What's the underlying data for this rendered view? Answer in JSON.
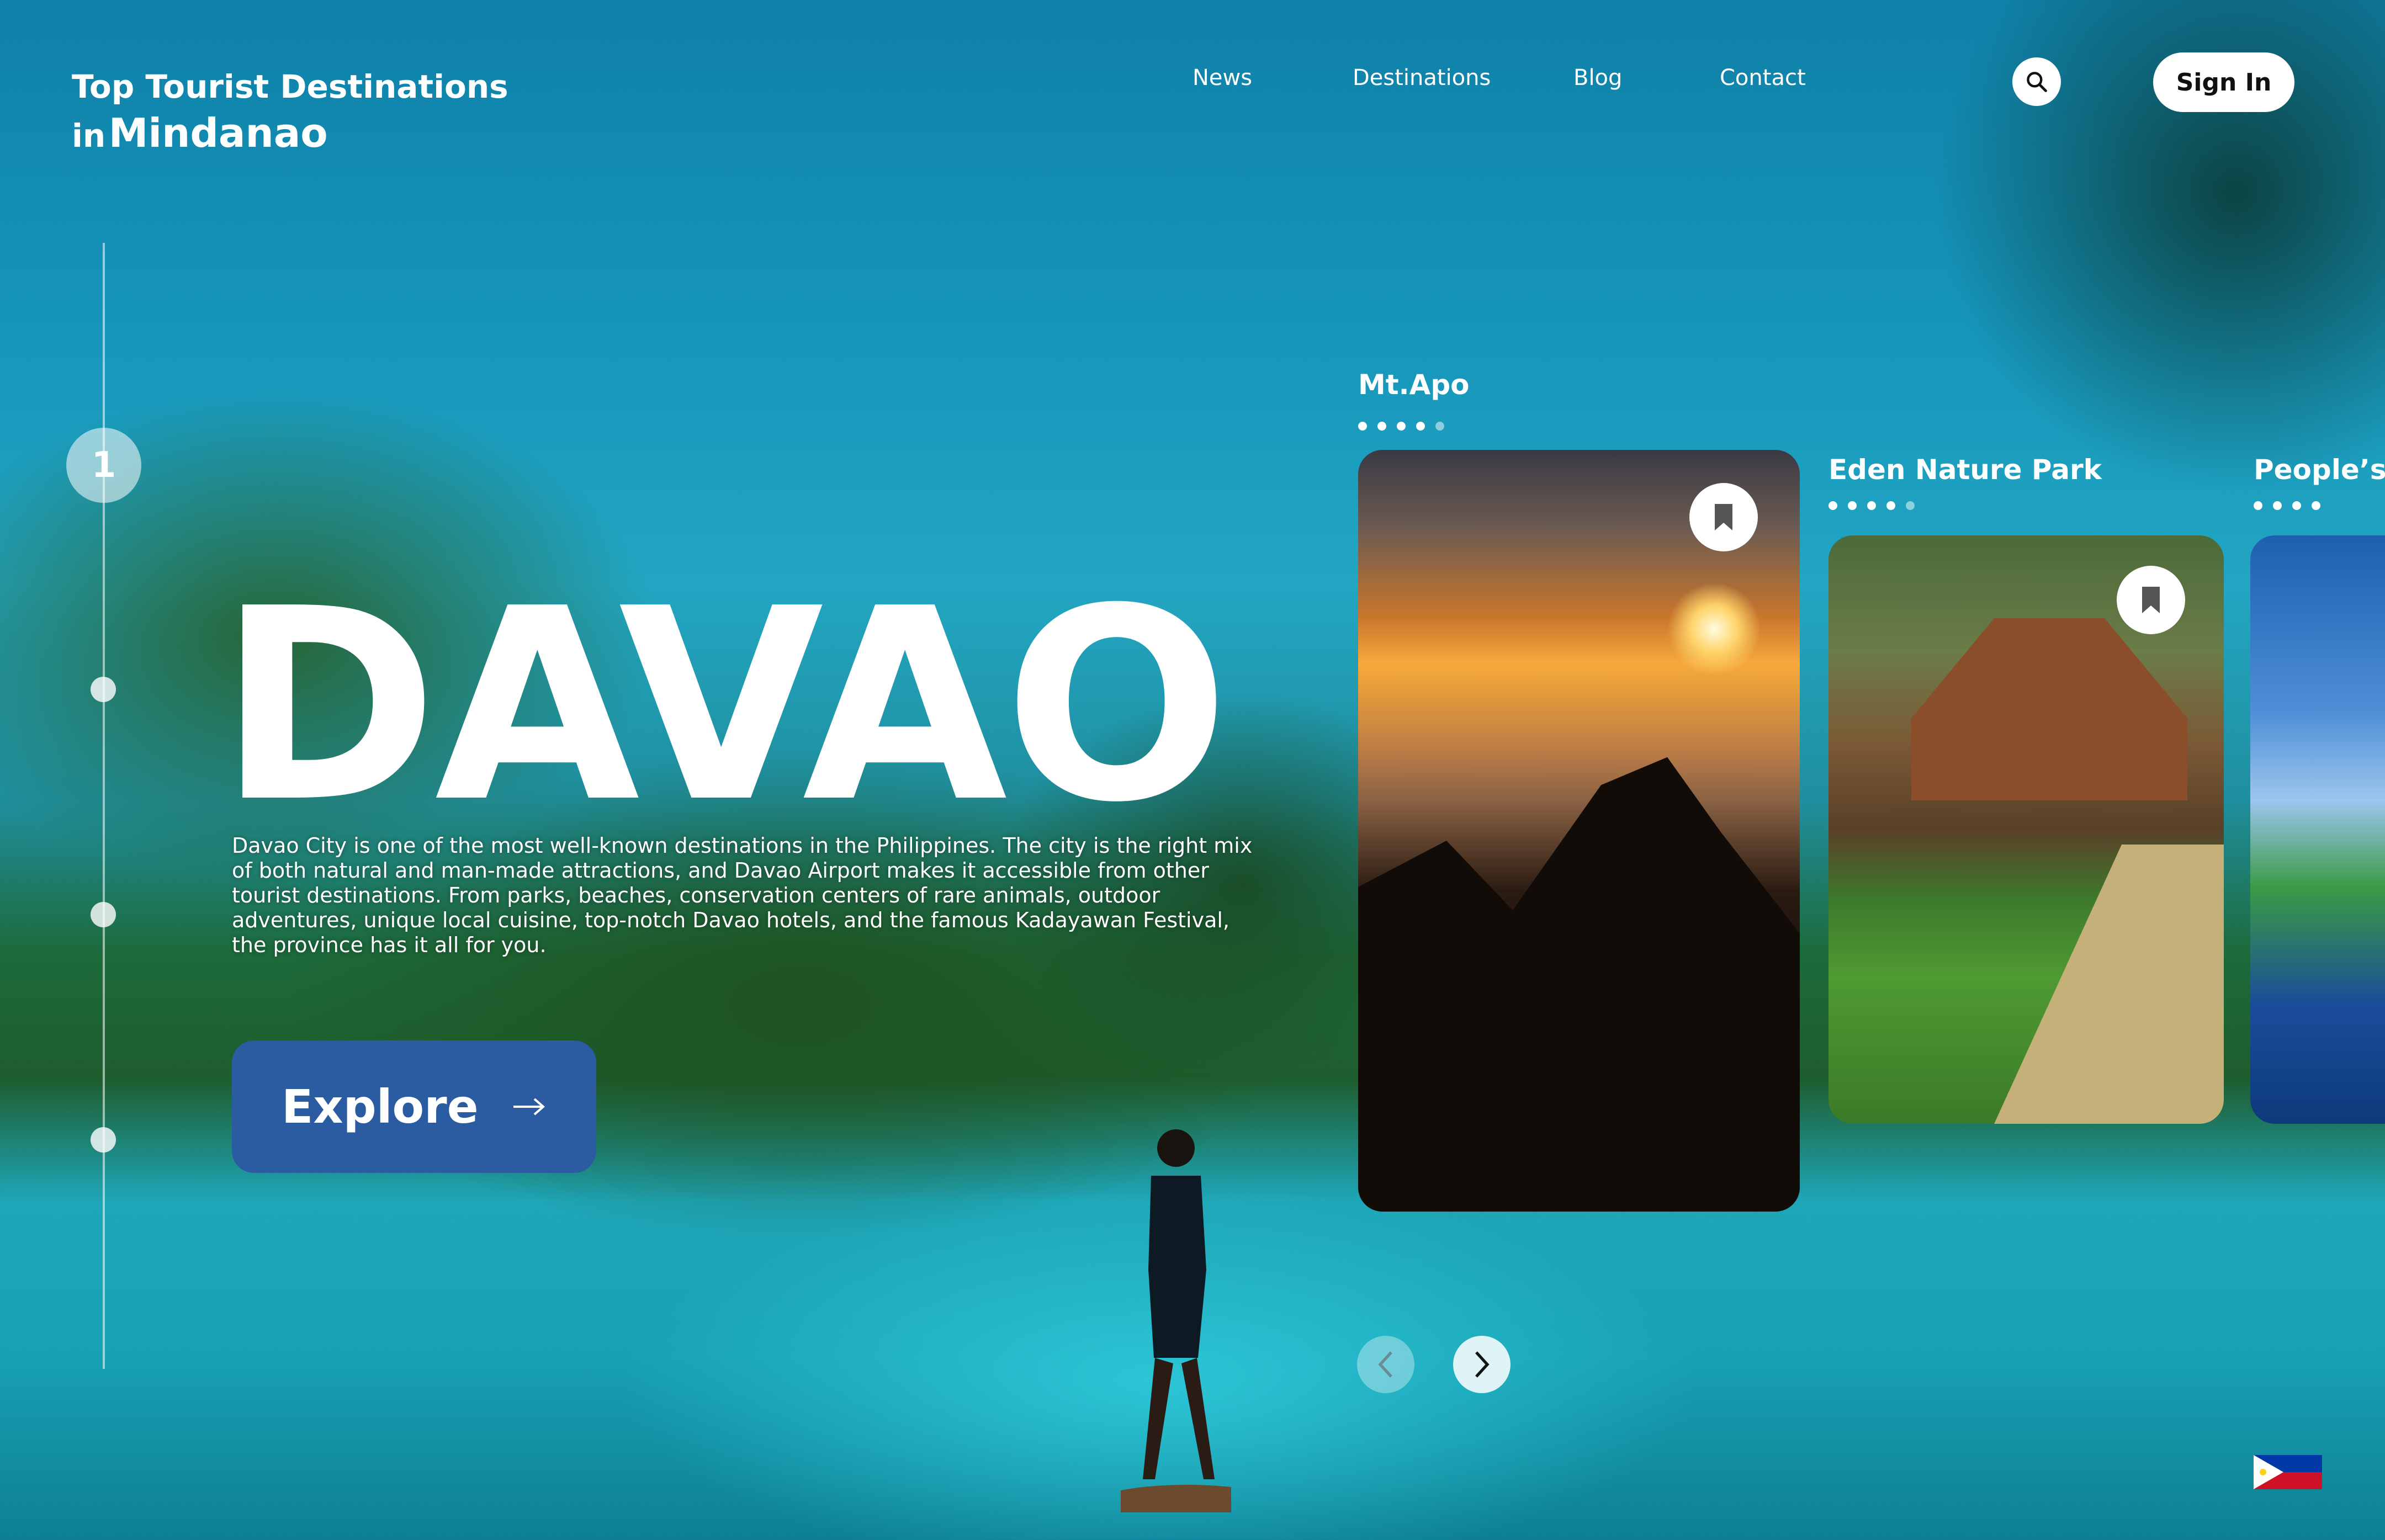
{
  "brand": {
    "line1": "Top Tourist Destinations",
    "line2_prefix": "in",
    "line2_main": "Mindanao"
  },
  "nav": {
    "items": [
      "News",
      "Destinations",
      "Blog",
      "Contact"
    ]
  },
  "header": {
    "sign_in_label": "Sign In",
    "search_icon": "search-icon"
  },
  "steps": {
    "active_number": "1",
    "count": 4
  },
  "hero": {
    "title": "DAVAO",
    "description": "Davao City is one of the most well-known destinations in the Philippines. The city is the right mix of both natural and man-made attractions, and Davao Airport makes it accessible from other tourist destinations. From parks, beaches, conservation centers of rare animals, outdoor adventures, unique local cuisine, top-notch Davao hotels, and the famous Kadayawan Festival, the province has it all for you.",
    "explore_label": "Explore"
  },
  "cards": [
    {
      "title": "Mt.Apo",
      "dots_total": 5,
      "dots_active": 4
    },
    {
      "title": "Eden Nature Park",
      "dots_total": 5,
      "dots_active": 4
    },
    {
      "title": "People’s P",
      "dots_total": 4,
      "dots_active": 4
    }
  ],
  "colors": {
    "accent": "#2b5ba1",
    "sky": "#1696bb",
    "water": "#18a0b4"
  }
}
